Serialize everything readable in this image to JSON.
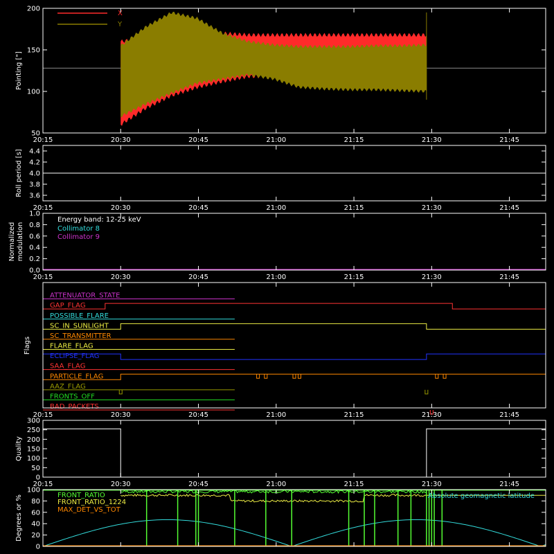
{
  "colors": {
    "background": "#000000",
    "axes": "#ffffff",
    "x_series": "#ff2a2a",
    "y_series": "#8a7d00",
    "cyan": "#33dddd",
    "magenta": "#cc33cc",
    "red": "#ff3333",
    "orange": "#ff8800",
    "yellow": "#eeee44",
    "blue": "#2233ff",
    "olive": "#999900",
    "green": "#22dd22",
    "bright_green": "#55ff33",
    "white": "#ffffff"
  },
  "time_axis": {
    "range_minutes": [
      15,
      52
    ],
    "ticks": [
      {
        "t": 15,
        "label": "20:15"
      },
      {
        "t": 30,
        "label": "20:30"
      },
      {
        "t": 45,
        "label": "20:45"
      },
      {
        "t": 60,
        "label": "21:00"
      },
      {
        "t": 75,
        "label": "21:15"
      },
      {
        "t": 90,
        "label": "21:30"
      },
      {
        "t": 105,
        "label": "21:45"
      }
    ]
  },
  "chart_data": [
    {
      "id": "pointing",
      "type": "area",
      "ylabel": "Pointing [\"]",
      "ylim": [
        50,
        200
      ],
      "yticks": [
        50,
        100,
        150,
        200
      ],
      "legend": [
        "X",
        "Y"
      ],
      "reference_level": 128,
      "data_span_minutes": [
        30,
        89
      ],
      "series": [
        {
          "name": "X",
          "min": [
            60,
            80,
            95,
            105,
            112,
            118,
            118,
            117,
            116,
            118,
            118,
            118,
            118
          ],
          "max": [
            160,
            165,
            168,
            170,
            170,
            168,
            168,
            168,
            168,
            168,
            168,
            168,
            168
          ]
        },
        {
          "name": "Y",
          "min": [
            70,
            85,
            98,
            110,
            115,
            120,
            115,
            105,
            103,
            102,
            102,
            101,
            100
          ],
          "max": [
            155,
            178,
            195,
            188,
            170,
            160,
            156,
            154,
            154,
            154,
            155,
            155,
            156
          ]
        }
      ]
    },
    {
      "id": "roll_period",
      "type": "line",
      "ylabel": "Roll period [s]",
      "ylim": [
        3.5,
        4.5
      ],
      "yticks": [
        3.6,
        3.8,
        4.0,
        4.2,
        4.4
      ],
      "tick_labels": [
        "3.6",
        "3.8",
        "4.0",
        "4.2",
        "4.4"
      ],
      "value": 4.0
    },
    {
      "id": "modulation",
      "type": "line",
      "ylabel": "Normalized modulation",
      "ylim": [
        0,
        1
      ],
      "yticks": [
        0,
        0.2,
        0.4,
        0.6,
        0.8,
        1.0
      ],
      "tick_labels": [
        "0.0",
        "0.2",
        "0.4",
        "0.6",
        "0.8",
        "1.0"
      ],
      "annotation": "Energy band: 12-25 keV",
      "legend": [
        {
          "name": "Collimator 8",
          "color": "#33dddd"
        },
        {
          "name": "Collimator 9",
          "color": "#cc33cc"
        }
      ],
      "value": 0.0
    },
    {
      "id": "flags",
      "type": "line",
      "ylabel": "Flags",
      "series": [
        {
          "name": "ATTENUATOR_STATE",
          "color": "#cc33cc",
          "segments": [
            [
              15,
              52,
              0
            ]
          ]
        },
        {
          "name": "GAP_FLAG",
          "color": "#ff3333",
          "segments": [
            [
              15,
              27,
              0
            ],
            [
              27,
              94,
              1
            ],
            [
              94,
              52,
              0
            ]
          ]
        },
        {
          "name": "POSSIBLE_FLARE",
          "color": "#33dddd",
          "segments": [
            [
              15,
              52,
              0
            ]
          ]
        },
        {
          "name": "SC_IN_SUNLIGHT",
          "color": "#eeee44",
          "segments": [
            [
              15,
              30,
              0
            ],
            [
              30,
              89,
              1
            ],
            [
              89,
              52,
              0
            ]
          ]
        },
        {
          "name": "SC_TRANSMITTER",
          "color": "#ff8800",
          "segments": [
            [
              15,
              52,
              0
            ]
          ]
        },
        {
          "name": "FLARE_FLAG",
          "color": "#eeee44",
          "segments": [
            [
              15,
              52,
              0
            ]
          ]
        },
        {
          "name": "ECLIPSE_FLAG",
          "color": "#2233ff",
          "segments": [
            [
              15,
              30,
              1
            ],
            [
              30,
              89,
              0
            ],
            [
              89,
              52,
              1
            ]
          ]
        },
        {
          "name": "SAA_FLAG",
          "color": "#ff3333",
          "segments": [
            [
              15,
              52,
              0
            ]
          ]
        },
        {
          "name": "PARTICLE_FLAG",
          "color": "#ff8800",
          "segments": [
            [
              15,
              30,
              0
            ],
            [
              30,
              89,
              1
            ],
            [
              89,
              52,
              1
            ]
          ],
          "spikes_minutes": [
            56.5,
            58,
            63.5,
            64.5,
            91,
            92.5
          ]
        },
        {
          "name": "AAZ_FLAG",
          "color": "#999900",
          "segments": [
            [
              15,
              52,
              0
            ]
          ],
          "spikes_minutes": [
            30,
            89
          ]
        },
        {
          "name": "FRONTS_OFF",
          "color": "#22dd22",
          "segments": [
            [
              15,
              52,
              0
            ]
          ]
        },
        {
          "name": "BAD_PACKETS",
          "color": "#ff3333",
          "segments": [
            [
              15,
              52,
              0
            ]
          ],
          "spikes_minutes": [
            90
          ]
        }
      ]
    },
    {
      "id": "quality",
      "type": "line",
      "ylabel": "Quality",
      "ylim": [
        0,
        300
      ],
      "yticks": [
        0,
        50,
        100,
        150,
        200,
        250,
        300
      ],
      "tick_labels": [
        "0",
        "50",
        "100",
        "150",
        "200",
        "250",
        "300"
      ],
      "segments": [
        [
          15,
          30,
          255
        ],
        [
          30,
          89,
          0
        ],
        [
          89,
          52,
          255
        ]
      ]
    },
    {
      "id": "ratios",
      "type": "line",
      "ylabel": "Degrees or %",
      "ylim": [
        0,
        100
      ],
      "yticks": [
        0,
        20,
        40,
        60,
        80,
        100
      ],
      "tick_labels": [
        "0",
        "20",
        "40",
        "60",
        "80",
        "100"
      ],
      "series": [
        {
          "name": "FRONT_RATIO",
          "color": "#55ff33"
        },
        {
          "name": "FRONT_RATIO_1224",
          "color": "#eeee44"
        },
        {
          "name": "MAX_DET_VS_TOT",
          "color": "#ff8800"
        },
        {
          "name": "Absolute geomagnetic latitude",
          "color": "#33dddd"
        }
      ],
      "latitude_peaks": [
        {
          "t": 39,
          "v": 47
        },
        {
          "t": 87,
          "v": 47
        }
      ],
      "latitude_zeros": [
        15,
        63,
        111
      ],
      "green_spikes_minutes": [
        35,
        41,
        44.5,
        45,
        52,
        58,
        63,
        74,
        77,
        79,
        83.5,
        86,
        89,
        89.5,
        90,
        90.5,
        92
      ]
    }
  ]
}
